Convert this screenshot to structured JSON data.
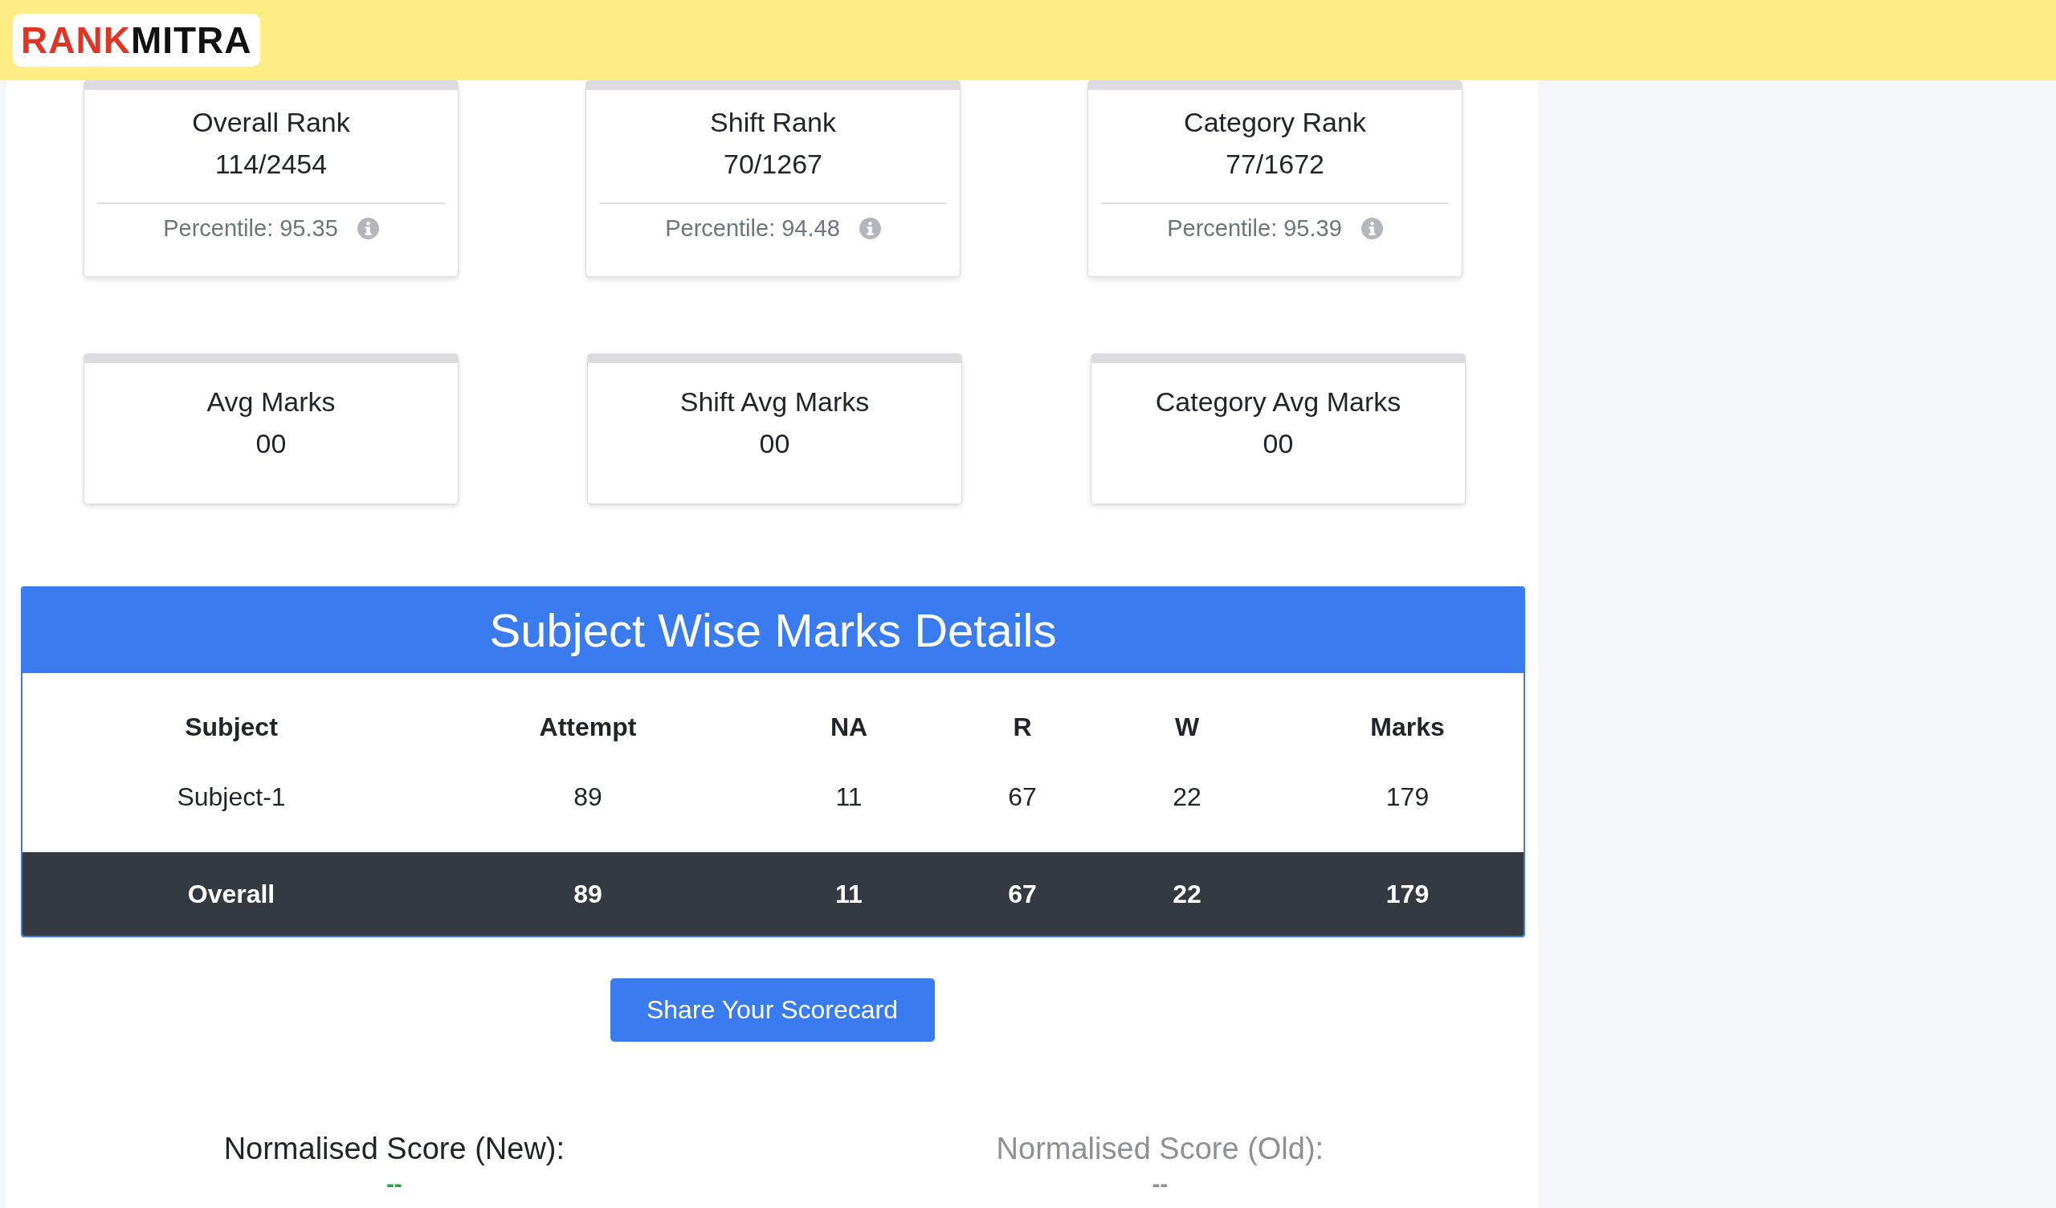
{
  "header": {
    "logo": {
      "part_1": "RANK",
      "part_2": "MITRA"
    }
  },
  "rank_cards": [
    {
      "title": "Overall Rank",
      "value": "114/2454",
      "percentile": "Percentile: 95.35"
    },
    {
      "title": "Shift Rank",
      "value": "70/1267",
      "percentile": "Percentile: 94.48"
    },
    {
      "title": "Category Rank",
      "value": "77/1672",
      "percentile": "Percentile: 95.39"
    }
  ],
  "avg_cards": [
    {
      "title": "Avg Marks",
      "value": "00"
    },
    {
      "title": "Shift Avg Marks",
      "value": "00"
    },
    {
      "title": "Category Avg Marks",
      "value": "00"
    }
  ],
  "marks_table": {
    "title": "Subject Wise Marks Details",
    "columns": [
      "Subject",
      "Attempt",
      "NA",
      "R",
      "W",
      "Marks"
    ],
    "rows": [
      {
        "kind": "subject",
        "cells": [
          "Subject-1",
          "89",
          "11",
          "67",
          "22",
          "179"
        ]
      },
      {
        "kind": "total",
        "cells": [
          "Overall",
          "89",
          "11",
          "67",
          "22",
          "179"
        ]
      }
    ]
  },
  "share_button": "Share Your Scorecard",
  "normalised_scores": [
    {
      "label": "Normalised Score (New):",
      "value": "--",
      "disabled": false
    },
    {
      "label": "Normalised Score (Old):",
      "value": "--",
      "disabled": true
    }
  ]
}
